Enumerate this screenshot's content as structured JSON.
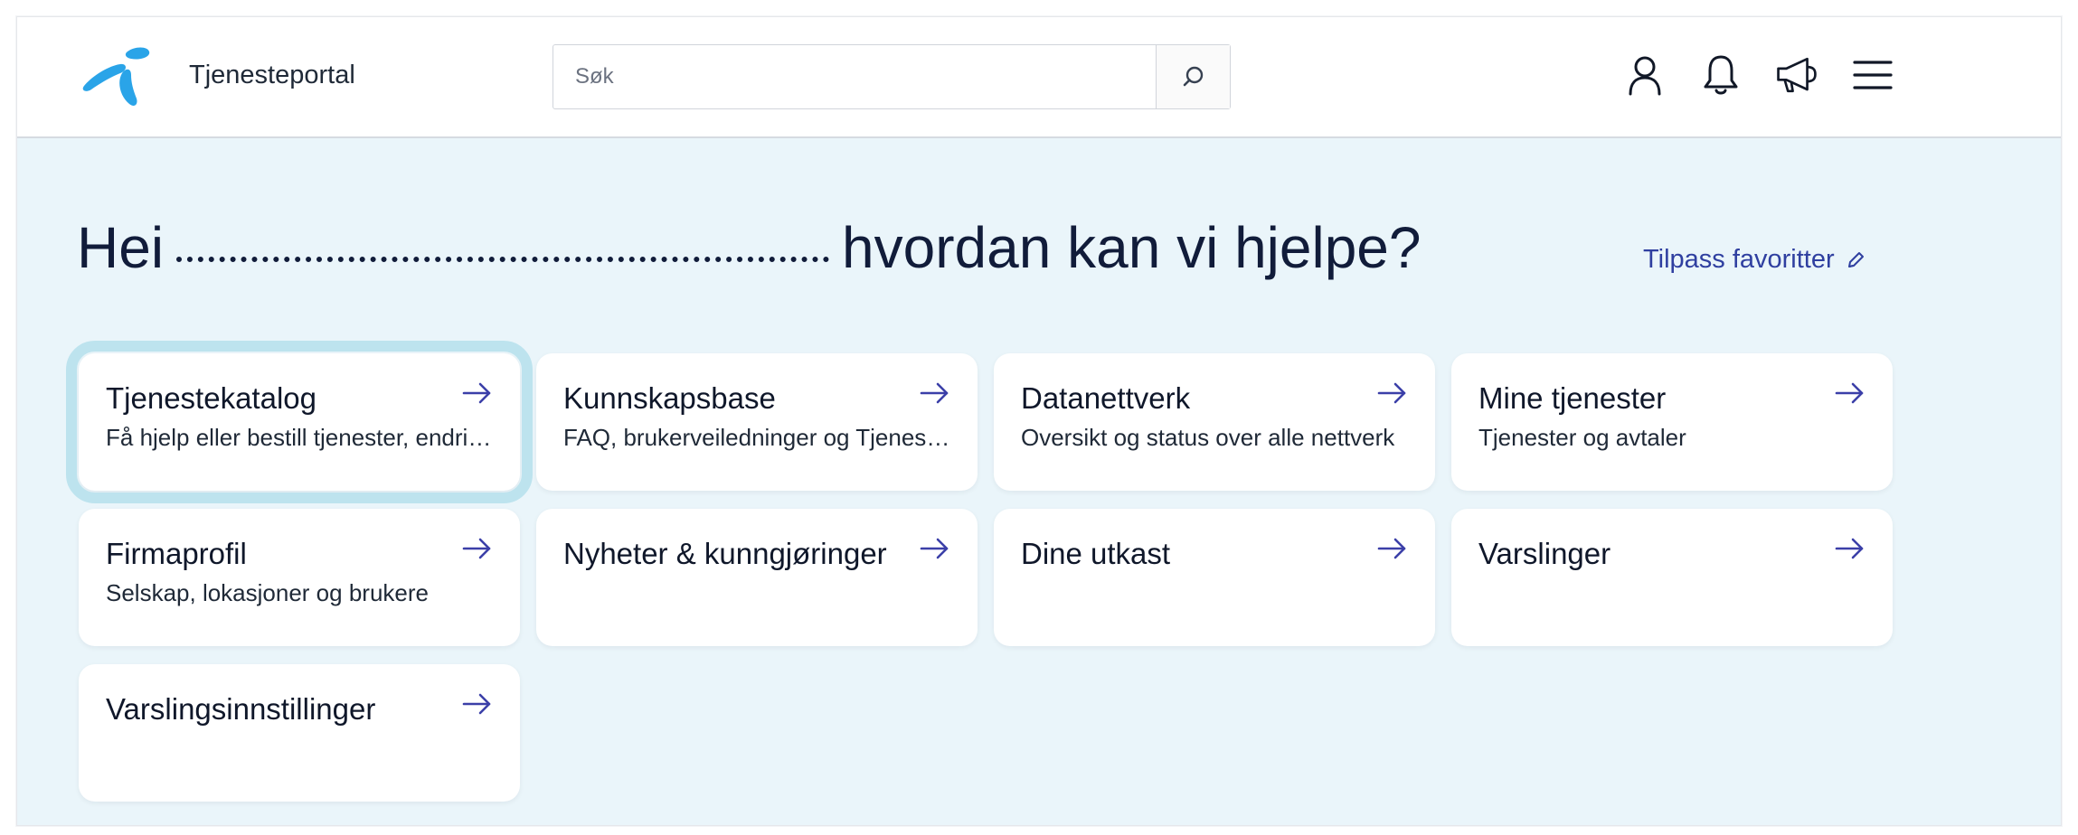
{
  "header": {
    "app_title": "Tjenesteportal",
    "search": {
      "placeholder": "Søk",
      "value": ""
    },
    "icons": [
      "user-icon",
      "bell-icon",
      "megaphone-icon",
      "menu-icon"
    ],
    "brand_color": "#2aa4e8"
  },
  "hero": {
    "greeting_start": "Hei",
    "greeting_end": "hvordan kan vi hjelpe?",
    "customize_label": "Tilpass favoritter"
  },
  "cards": [
    {
      "title": "Tjenestekatalog",
      "subtitle": "Få hjelp eller bestill tjenester, endringer, rapporter feil..."
    },
    {
      "title": "Kunnskapsbase",
      "subtitle": "FAQ, brukerveiledninger og Tjenestebeskrivelser"
    },
    {
      "title": "Datanettverk",
      "subtitle": "Oversikt og status over alle nettverk"
    },
    {
      "title": "Mine tjenester",
      "subtitle": "Tjenester og avtaler"
    },
    {
      "title": "Firmaprofil",
      "subtitle": "Selskap, lokasjoner og brukere"
    },
    {
      "title": "Nyheter & kunngjøringer",
      "subtitle": ""
    },
    {
      "title": "Dine utkast",
      "subtitle": ""
    },
    {
      "title": "Varslinger",
      "subtitle": ""
    },
    {
      "title": "Varslingsinnstillinger",
      "subtitle": ""
    }
  ],
  "colors": {
    "background": "#eaf5fa",
    "accent_link": "#2f3fa0",
    "heading": "#111c3a"
  }
}
